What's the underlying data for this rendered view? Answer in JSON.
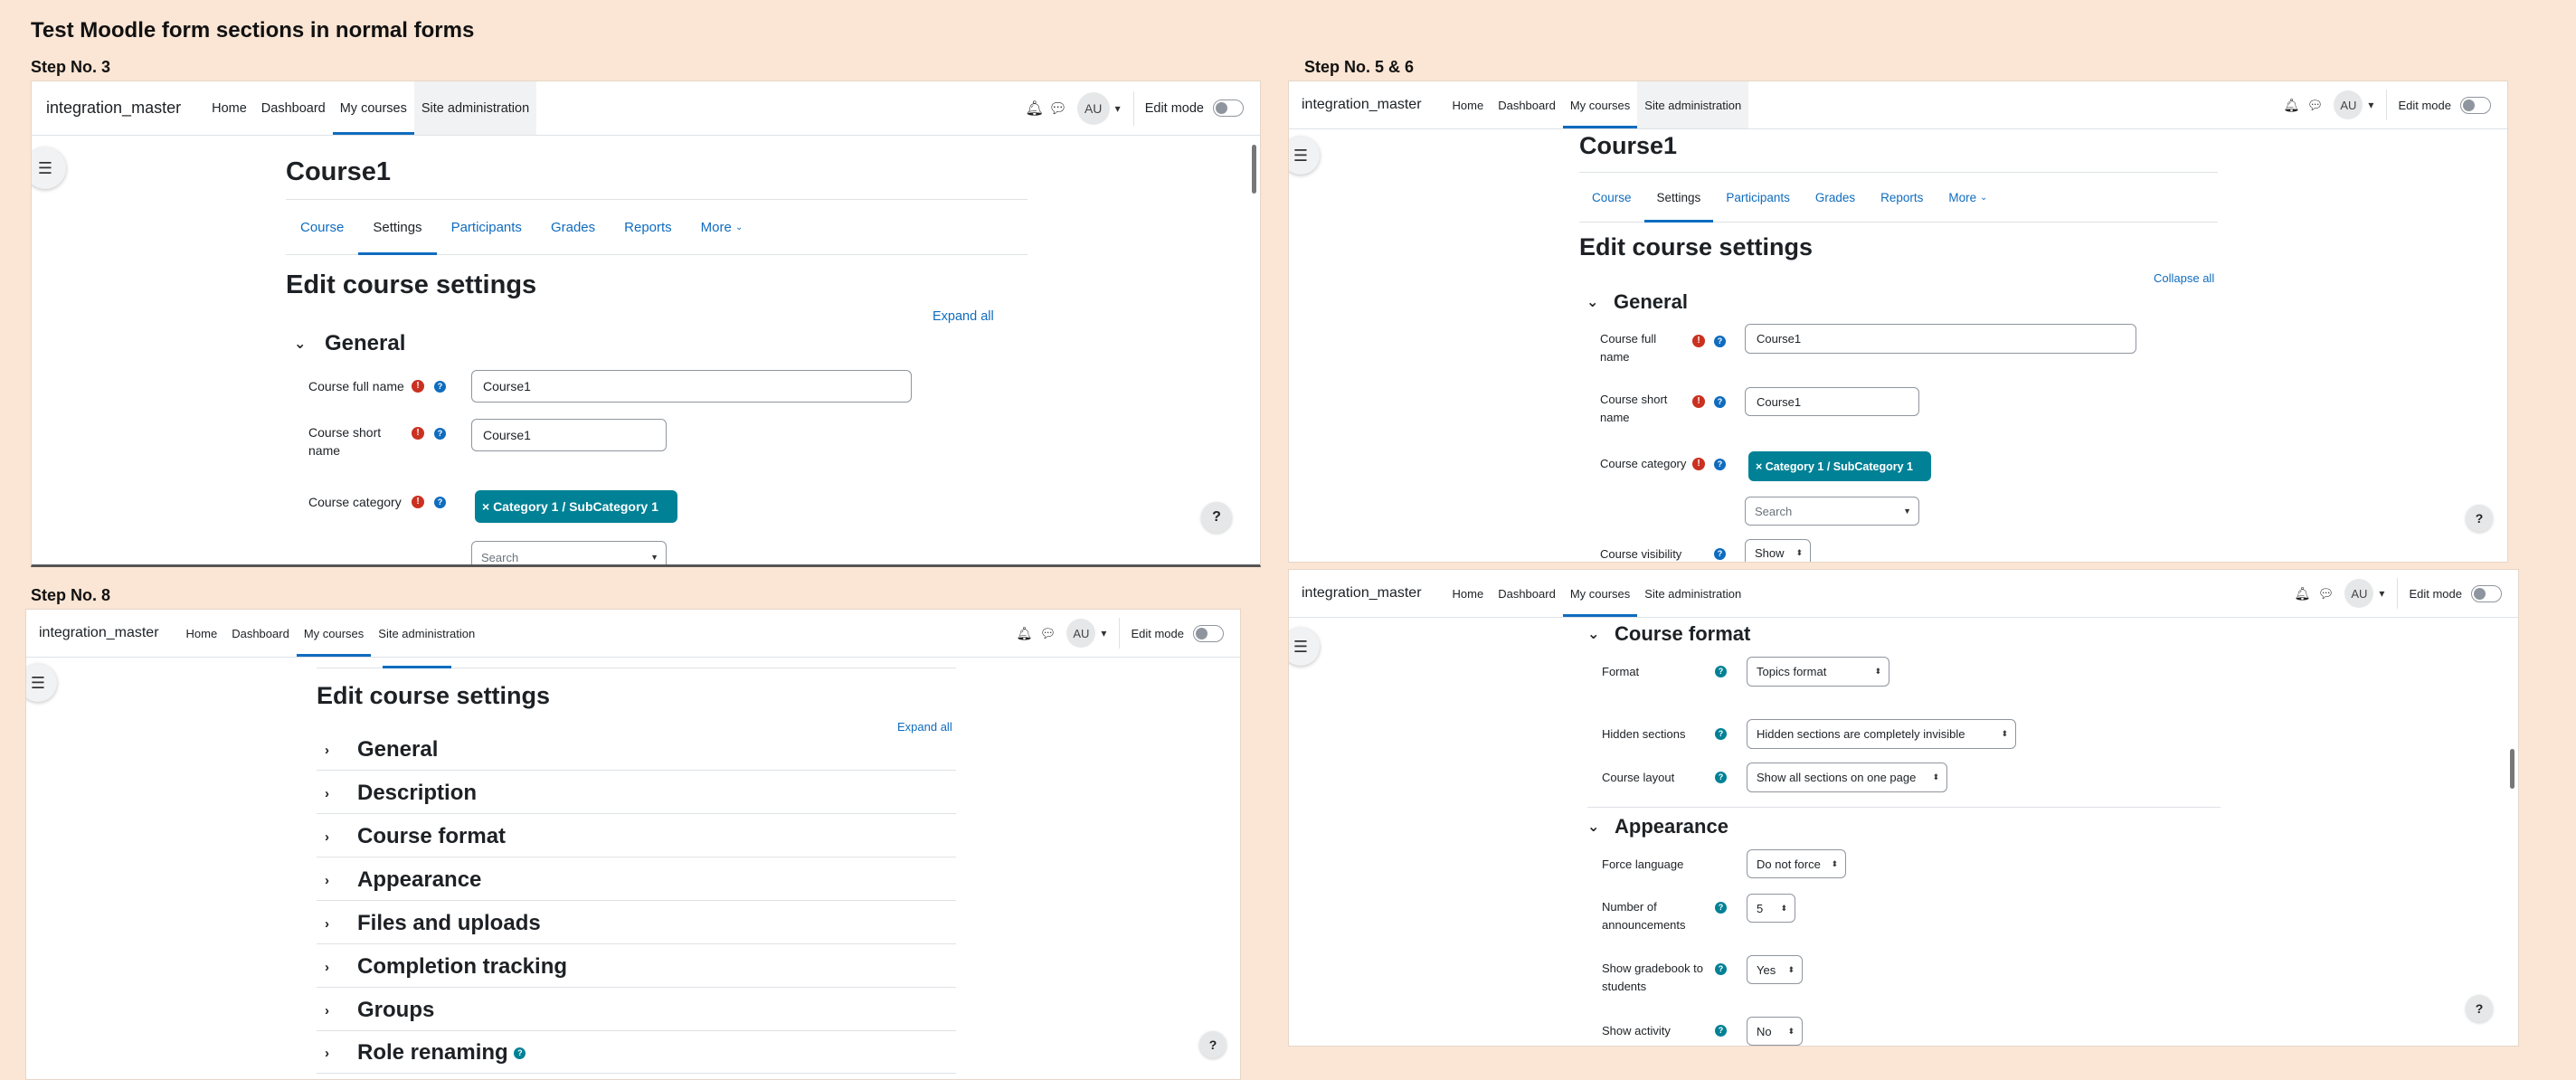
{
  "page_title": "Test Moodle form sections in normal forms",
  "steps": {
    "s3": "Step No. 3",
    "s56": "Step No. 5 & 6",
    "s8": "Step No. 8"
  },
  "navbar": {
    "brand": "integration_master",
    "home": "Home",
    "dashboard": "Dashboard",
    "mycourses": "My courses",
    "siteadmin": "Site administration",
    "avatar": "AU",
    "editmode": "Edit mode"
  },
  "course": {
    "title": "Course1",
    "tabs": [
      "Course",
      "Settings",
      "Participants",
      "Grades",
      "Reports",
      "More"
    ]
  },
  "form": {
    "heading": "Edit course settings",
    "expand_all": "Expand all",
    "collapse_all": "Collapse all",
    "general": "General",
    "fullname_label_a": "Course full name",
    "fullname_label_b1": "Course full",
    "fullname_label_b2": "name",
    "fullname_value": "Course1",
    "shortname_label_1": "Course short",
    "shortname_label_2": "name",
    "shortname_value": "Course1",
    "category_label": "Course category",
    "category_value": "× Category 1 / SubCategory 1",
    "search_placeholder": "Search",
    "visibility_label": "Course visibility",
    "visibility_value": "Show"
  },
  "sections": [
    "General",
    "Description",
    "Course format",
    "Appearance",
    "Files and uploads",
    "Completion tracking",
    "Groups",
    "Role renaming"
  ],
  "format_section": {
    "title": "Course format",
    "format_label": "Format",
    "format_value": "Topics format",
    "hidden_label": "Hidden sections",
    "hidden_value": "Hidden sections are completely invisible",
    "layout_label": "Course layout",
    "layout_value": "Show all sections on one page"
  },
  "appearance_section": {
    "title": "Appearance",
    "lang_label": "Force language",
    "lang_value": "Do not force",
    "ann_label_1": "Number of",
    "ann_label_2": "announcements",
    "ann_value": "5",
    "grade_label_1": "Show gradebook to",
    "grade_label_2": "students",
    "grade_value": "Yes",
    "activity_label": "Show activity",
    "activity_value": "No"
  },
  "colors": {
    "accent": "#0f6cbf",
    "teal": "#008196",
    "required": "#ca3120",
    "background": "#fbe5d4"
  },
  "icons": [
    "bell-icon",
    "chat-icon",
    "drawer-icon",
    "help-icon",
    "chevron-down-icon",
    "chevron-right-icon",
    "required-icon",
    "info-icon"
  ]
}
